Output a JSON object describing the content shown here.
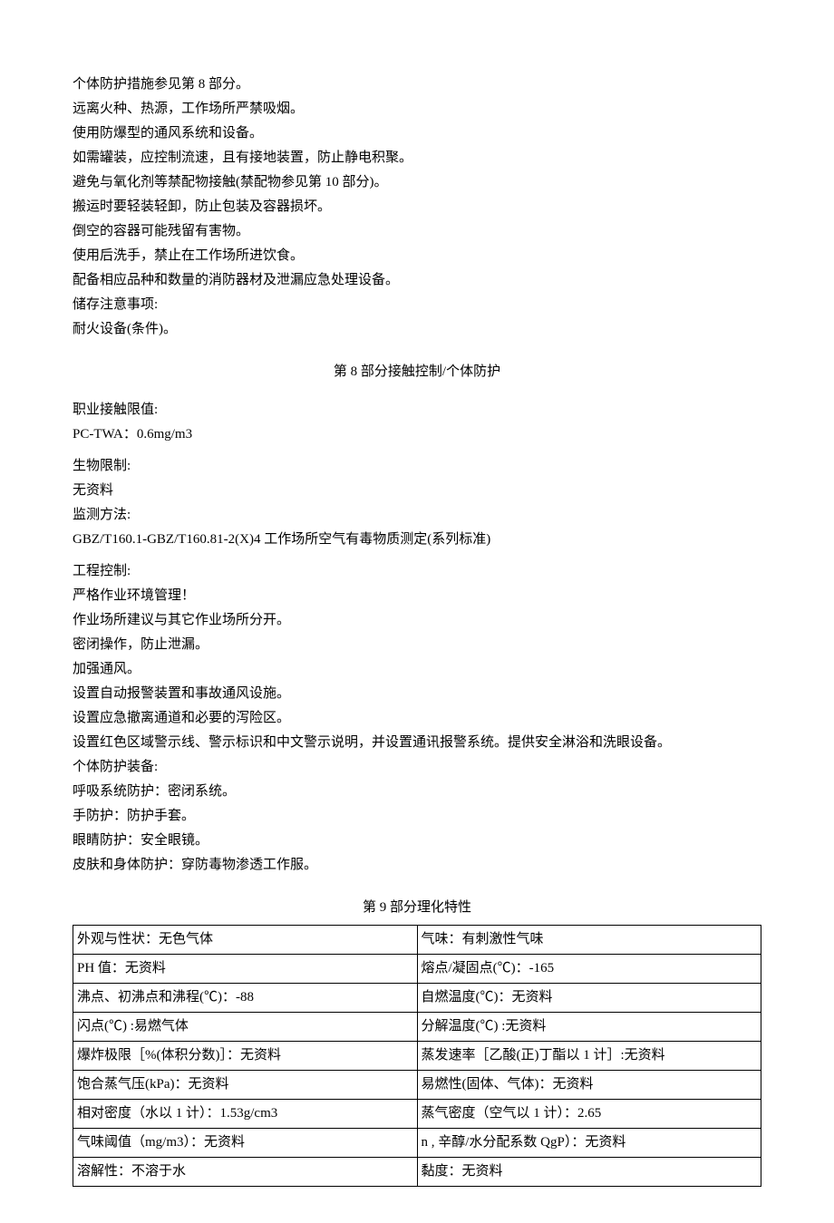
{
  "lines_top": [
    "个体防护措施参见第 8 部分。",
    "远离火种、热源，工作场所严禁吸烟。",
    "使用防爆型的通风系统和设备。",
    "如需罐装，应控制流速，且有接地装置，防止静电积聚。",
    "避免与氧化剂等禁配物接触(禁配物参见第 10 部分)。",
    "搬运时要轻装轻卸，防止包装及容器损坏。",
    "倒空的容器可能残留有害物。",
    "使用后洗手，禁止在工作场所进饮食。",
    "配备相应品种和数量的消防器材及泄漏应急处理设备。",
    "储存注意事项:",
    "耐火设备(条件)。"
  ],
  "section8_title": "第 8 部分接触控制/个体防护",
  "section8_lines": [
    "职业接触限值:",
    "PC-TWA：0.6mg/m3",
    "生物限制:",
    "无资料",
    "监测方法:",
    "GBZ/T160.1-GBZ/T160.81-2(X)4 工作场所空气有毒物质测定(系列标准)",
    "工程控制:",
    "严格作业环境管理！",
    "作业场所建议与其它作业场所分开。",
    "密闭操作，防止泄漏。",
    "加强通风。",
    "设置自动报警装置和事故通风设施。",
    "设置应急撤离通道和必要的泻险区。",
    "设置红色区域警示线、警示标识和中文警示说明，并设置通讯报警系统。提供安全淋浴和洗眼设备。",
    "个体防护装备:",
    "呼吸系统防护：密闭系统。",
    "手防护：防护手套。",
    "眼睛防护：安全眼镜。",
    "皮肤和身体防护：穿防毒物渗透工作服。"
  ],
  "section9_title": "第 9 部分理化特性",
  "table_rows": [
    {
      "left": "外观与性状：无色气体",
      "right": "气味：有刺激性气味"
    },
    {
      "left": "PH 值：无资料",
      "right": "熔点/凝固点(℃)：-165"
    },
    {
      "left": "沸点、初沸点和沸程(℃)：-88",
      "right": "自燃温度(℃)：无资料"
    },
    {
      "left": "闪点(℃) :易燃气体",
      "right": "分解温度(℃) :无资料"
    },
    {
      "left": "爆炸极限［%(体积分数)］：无资料",
      "right": "蒸发速率［乙酸(正)丁酯以 1 计］:无资料"
    },
    {
      "left": "饱合蒸气压(kPa)：无资料",
      "right": "易燃性(固体、气体)：无资料"
    },
    {
      "left": "相对密度（水以 1 计）：1.53g/cm3",
      "right": "蒸气密度（空气以 1 计）：2.65"
    },
    {
      "left": "气味阈值（mg/m3）：无资料",
      "right": "n , 辛醇/水分配系数 QgP）：无资料"
    },
    {
      "left": "溶解性：不溶于水",
      "right": "黏度：无资料"
    }
  ]
}
